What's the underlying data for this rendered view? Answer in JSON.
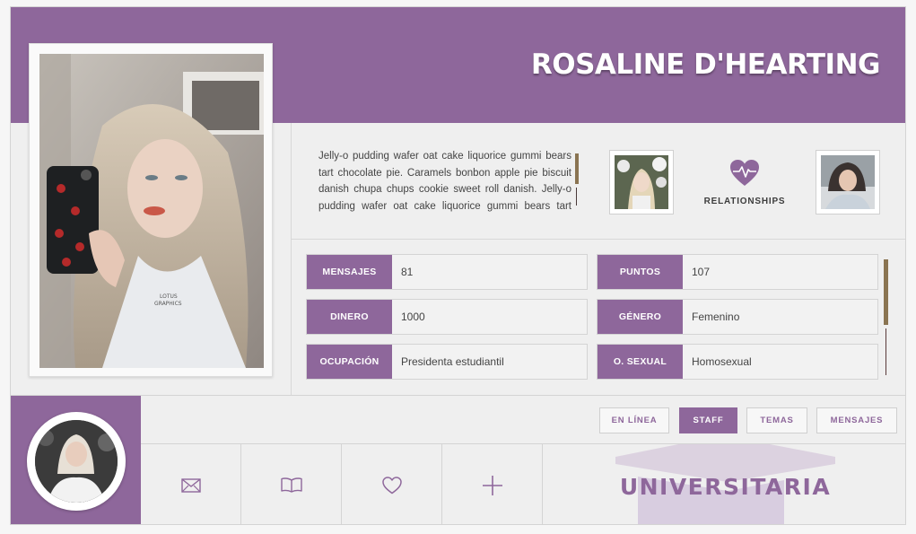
{
  "profile": {
    "name": "ROSALINE D'HEARTING",
    "bio": "Jelly-o pudding wafer oat cake liquorice gummi bears tart chocolate pie. Caramels bonbon apple pie biscuit danish chupa chups cookie sweet roll danish. Jelly-o pudding wafer oat cake liquorice gummi bears tart chocolate pie.",
    "photo_watermark": "LOTUS GRAPHICS"
  },
  "relationships": {
    "label": "RELATIONSHIPS"
  },
  "stats": [
    {
      "label": "MENSAJES",
      "value": "81"
    },
    {
      "label": "PUNTOS",
      "value": "107"
    },
    {
      "label": "DINERO",
      "value": "1000"
    },
    {
      "label": "GÉNERO",
      "value": "Femenino"
    },
    {
      "label": "OCUPACIÓN",
      "value": "Presidenta estudiantil"
    },
    {
      "label": "O. SEXUAL",
      "value": "Homosexual"
    }
  ],
  "buttons": {
    "online": "EN LÍNEA",
    "staff": "STAFF",
    "temas": "TEMAS",
    "mensajes": "MENSAJES"
  },
  "icons": [
    "envelope-icon",
    "book-icon",
    "heart-icon",
    "plus-icon"
  ],
  "badge": {
    "text": "UNIVERSITARIA"
  },
  "colors": {
    "accent": "#8e679b",
    "scroll": "#8a7451",
    "background": "#efefef"
  }
}
